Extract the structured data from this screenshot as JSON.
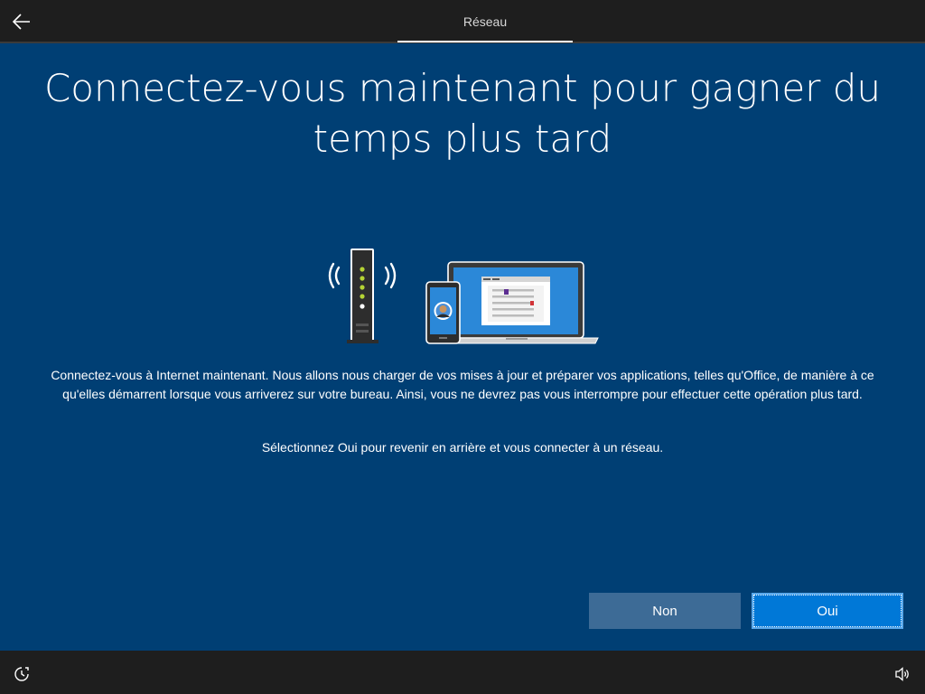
{
  "header": {
    "back_icon": "back-arrow-icon",
    "step_label": "Réseau"
  },
  "main": {
    "title": "Connectez-vous maintenant pour gagner du temps plus tard",
    "description": "Connectez-vous à Internet maintenant. Nous allons nous charger de vos mises à jour et préparer vos applications, telles qu'Office, de manière à ce qu'elles démarrent lorsque vous arriverez sur votre bureau. Ainsi, vous ne devrez pas vous interrompre pour effectuer cette opération plus tard.",
    "instruction": "Sélectionnez Oui pour revenir en arrière et vous connecter à un réseau."
  },
  "actions": {
    "no_label": "Non",
    "yes_label": "Oui"
  },
  "footer": {
    "accessibility_icon": "ease-of-access-icon",
    "volume_icon": "volume-icon"
  },
  "colors": {
    "background": "#003f74",
    "bar": "#1e1e1e",
    "primary_button": "#0078d7",
    "secondary_button": "#3d6b96",
    "router_lights": "#b5d334"
  }
}
